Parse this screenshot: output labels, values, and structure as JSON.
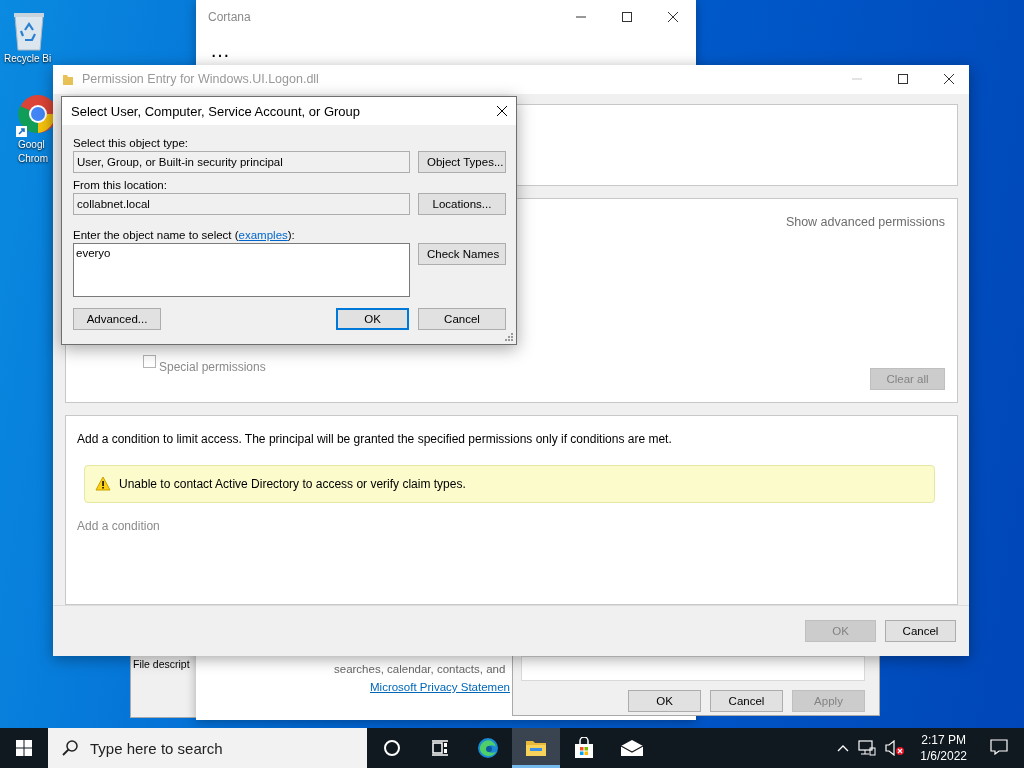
{
  "desktop_icons": [
    {
      "kind": "recycle",
      "lines": [
        "Recycle Bi"
      ]
    },
    {
      "kind": "browser",
      "lines": [
        "Googl",
        "Chrom"
      ]
    }
  ],
  "properties_window": {
    "field_label": "File descript"
  },
  "cortana": {
    "title": "Cortana",
    "ellipsis": "…",
    "text": "searches, calendar, contacts, and",
    "link": "Microsoft Privacy Statemen"
  },
  "security_window": {
    "buttons": [
      {
        "label": "OK",
        "disabled": false
      },
      {
        "label": "Cancel",
        "disabled": false
      },
      {
        "label": "Apply",
        "disabled": true
      }
    ]
  },
  "permission_entry": {
    "title": "Permission Entry for Windows.UI.Logon.dll",
    "show_advanced": "Show advanced permissions",
    "special": {
      "label": "Special permissions",
      "checked": false,
      "disabled": true
    },
    "clear_all": {
      "label": "Clear all",
      "disabled": true
    },
    "condition_text": "Add a condition to limit access. The principal will be granted the specified permissions only if conditions are met.",
    "warning": "Unable to contact Active Directory to access or verify claim types.",
    "add_condition": "Add a condition",
    "buttons": [
      {
        "label": "OK",
        "disabled": true
      },
      {
        "label": "Cancel",
        "disabled": false
      }
    ]
  },
  "select_dialog": {
    "title": "Select User, Computer, Service Account, or Group",
    "type_label": "Select this object type:",
    "type_value": "User, Group, or Built-in security principal",
    "type_button": "Object Types...",
    "location_label": "From this location:",
    "location_value": "collabnet.local",
    "location_button": "Locations...",
    "name_label": "Enter the object name to select (",
    "name_link": "examples",
    "name_label_end": "):",
    "name_value": "everyo",
    "check_button": "Check Names",
    "advanced_button": "Advanced...",
    "ok_button": "OK",
    "cancel_button": "Cancel"
  },
  "taskbar": {
    "search_placeholder": "Type here to search",
    "apps": [
      {
        "kind": "cortana",
        "selected": false
      },
      {
        "kind": "taskview",
        "selected": false
      },
      {
        "kind": "browser",
        "selected": false
      },
      {
        "kind": "explorer",
        "selected": true
      },
      {
        "kind": "store",
        "selected": false
      },
      {
        "kind": "mail",
        "selected": false
      }
    ],
    "time": "2:17 PM",
    "date": "1/6/2022"
  }
}
